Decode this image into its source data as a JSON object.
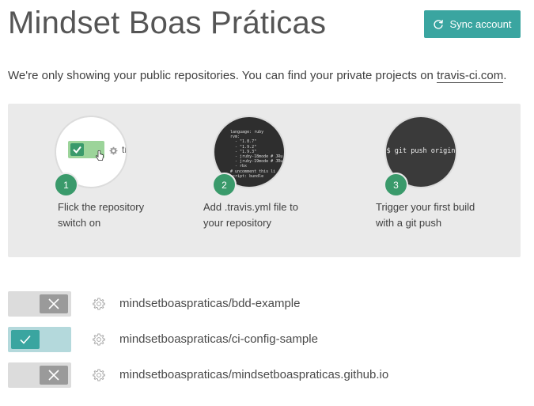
{
  "header": {
    "title": "Mindset Boas Práticas",
    "sync_label": "Sync account"
  },
  "notice": {
    "text": "We're only showing your public repositories. You can find your private projects on ",
    "link": "travis-ci.com",
    "suffix": "."
  },
  "steps": [
    {
      "number": "1",
      "text": "Flick the repository switch on",
      "preview_label": "tra"
    },
    {
      "number": "2",
      "text": "Add .travis.yml file to your repository"
    },
    {
      "number": "3",
      "text": "Trigger your first build with a git push",
      "command": "$ git push origin"
    }
  ],
  "yaml_preview": "language: ruby\nrvm:\n  - \"1.8.7\"\n  - \"1.9.2\"\n  - \"1.9.3\"\n  - jruby-18mode # JRu\n  - jruby-19mode # JRu\n  - rbx\n# uncomment this li\nscript: bundle",
  "repositories": [
    {
      "name": "mindsetboaspraticas/bdd-example",
      "enabled": false
    },
    {
      "name": "mindsetboaspraticas/ci-config-sample",
      "enabled": true
    },
    {
      "name": "mindsetboaspraticas/mindsetboaspraticas.github.io",
      "enabled": false
    }
  ],
  "colors": {
    "accent": "#3aa5a0",
    "step_badge": "#3a9a6b",
    "toggle_off": "#dcdcdc",
    "toggle_on": "#b4d9dc"
  }
}
